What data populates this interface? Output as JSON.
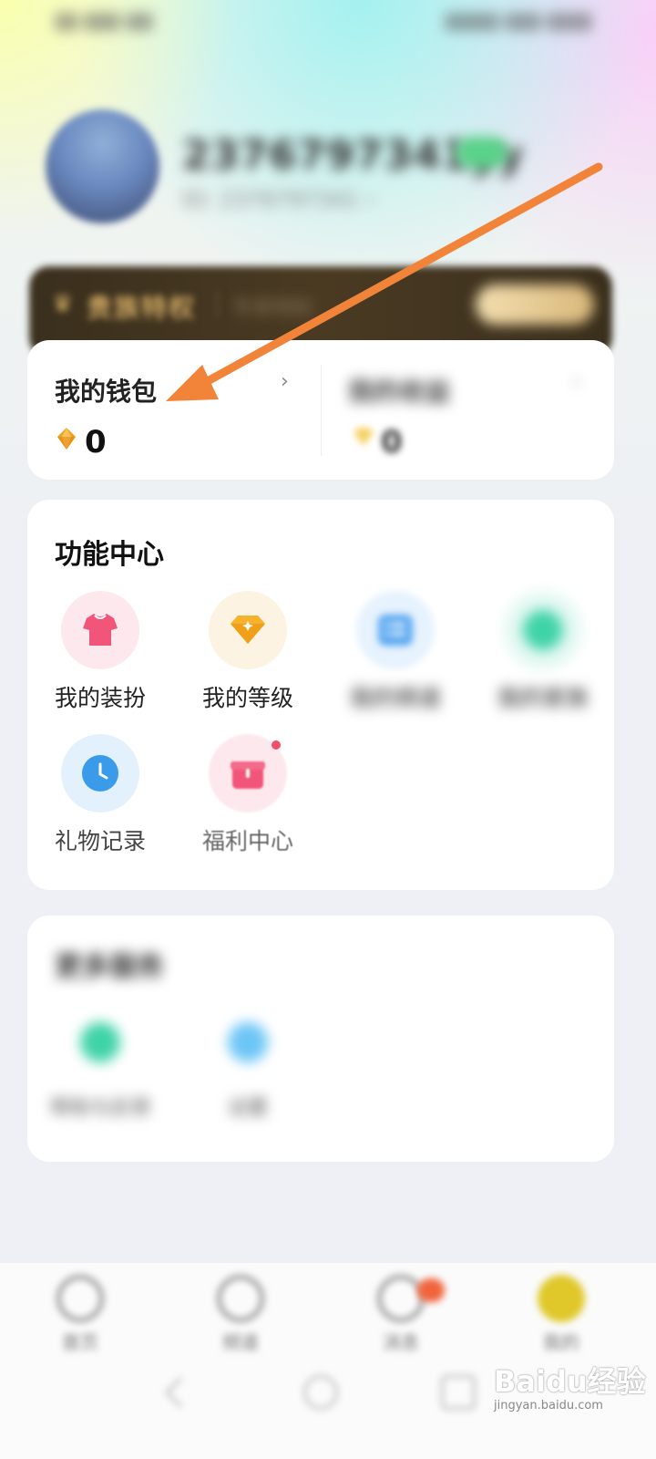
{
  "status_bar": {},
  "profile": {
    "username": "2376797341yy",
    "subtitle": "ID: 2376797341 ›"
  },
  "noble": {
    "title": "贵族特权",
    "subtitle": "专享特权"
  },
  "wallet": {
    "title": "我的钱包",
    "value": "0",
    "second_title": "我的收益",
    "second_value": "0"
  },
  "function_center": {
    "title": "功能中心",
    "items": [
      {
        "label": "我的装扮",
        "icon": "shirt-icon",
        "color": "#f2557a",
        "bg": "#fde8ee"
      },
      {
        "label": "我的等级",
        "icon": "diamond-icon",
        "color": "#f5b22d",
        "bg": "#fdf3e2"
      },
      {
        "label": "我的频道",
        "icon": "list-icon",
        "color": "#5aa8f0",
        "bg": "#e6f2fd"
      },
      {
        "label": "我的家族",
        "icon": "group-icon",
        "color": "#3fd3a8",
        "bg": "#e3f8f2"
      },
      {
        "label": "礼物记录",
        "icon": "clock-icon",
        "color": "#3a9bea",
        "bg": "#e3f1fd"
      },
      {
        "label": "福利中心",
        "icon": "gift-icon",
        "color": "#f2557a",
        "bg": "#fde8ee"
      }
    ]
  },
  "more_services": {
    "title": "更多服务",
    "items": [
      {
        "label": "帮助与反馈",
        "icon": "help-icon",
        "color": "#3fd3a8"
      },
      {
        "label": "设置",
        "icon": "settings-icon",
        "color": "#6cc6f5"
      }
    ]
  },
  "bottom_nav": [
    {
      "label": "首页",
      "icon": "home-icon"
    },
    {
      "label": "频道",
      "icon": "channel-icon"
    },
    {
      "label": "消息",
      "icon": "message-icon"
    },
    {
      "label": "我的",
      "icon": "profile-icon"
    }
  ],
  "watermark": {
    "logo": "Baidu经验",
    "url": "jingyan.baidu.com"
  },
  "colors": {
    "accent_orange": "#f2843a",
    "wallet_diamond": "#f0a020"
  }
}
